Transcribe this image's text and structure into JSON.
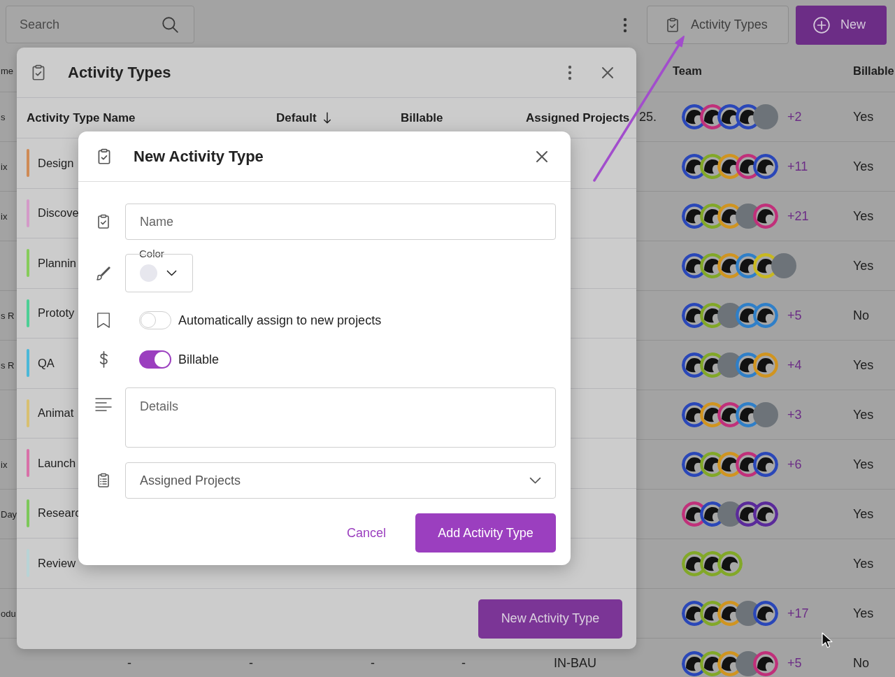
{
  "top_bar": {
    "search": {
      "placeholder": "Search"
    },
    "activity_types_button": {
      "label": "Activity Types"
    },
    "new_button": {
      "label": "New"
    }
  },
  "background_table": {
    "header": {
      "column_1": "me",
      "team": "Team",
      "billable": "Billable"
    },
    "rows": [
      {
        "column_1": "s",
        "column_7": "25.",
        "avatars": [
          {
            "kind": "illustration",
            "color": "#2a47b8"
          },
          {
            "kind": "illustration",
            "color": "#c0307a"
          },
          {
            "kind": "illustration",
            "color": "#2a47b8"
          },
          {
            "kind": "illustration",
            "color": "#2a47b8"
          },
          {
            "kind": "photo"
          }
        ],
        "more": "+2",
        "billable": "Yes"
      },
      {
        "column_1": "ix",
        "avatars": [
          {
            "kind": "illustration",
            "color": "#2a47b8"
          },
          {
            "kind": "illustration",
            "color": "#82a828"
          },
          {
            "kind": "illustration",
            "color": "#d09420"
          },
          {
            "kind": "illustration",
            "color": "#c0307a"
          },
          {
            "kind": "illustration",
            "color": "#2a47b8"
          }
        ],
        "more": "+11",
        "billable": "Yes"
      },
      {
        "column_1": "ix",
        "avatars": [
          {
            "kind": "illustration",
            "color": "#2a47b8"
          },
          {
            "kind": "illustration",
            "color": "#82a828"
          },
          {
            "kind": "illustration",
            "color": "#d09420"
          },
          {
            "kind": "photo"
          },
          {
            "kind": "illustration",
            "color": "#c0307a"
          }
        ],
        "more": "+21",
        "billable": "Yes"
      },
      {
        "avatars": [
          {
            "kind": "illustration",
            "color": "#2a47b8"
          },
          {
            "kind": "illustration",
            "color": "#82a828"
          },
          {
            "kind": "illustration",
            "color": "#d09420"
          },
          {
            "kind": "illustration",
            "color": "#2f7fc8"
          },
          {
            "kind": "illustration",
            "color": "#c8b820"
          },
          {
            "kind": "photo"
          }
        ],
        "billable": "Yes"
      },
      {
        "column_1": "s R",
        "avatars": [
          {
            "kind": "illustration",
            "color": "#2a47b8"
          },
          {
            "kind": "illustration",
            "color": "#82a828"
          },
          {
            "kind": "photo"
          },
          {
            "kind": "illustration",
            "color": "#2f7fc8"
          },
          {
            "kind": "illustration",
            "color": "#2f7fc8"
          }
        ],
        "more": "+5",
        "billable": "No"
      },
      {
        "column_1": "s R",
        "avatars": [
          {
            "kind": "illustration",
            "color": "#2a47b8"
          },
          {
            "kind": "illustration",
            "color": "#82a828"
          },
          {
            "kind": "photo"
          },
          {
            "kind": "illustration",
            "color": "#2f7fc8"
          },
          {
            "kind": "illustration",
            "color": "#d09420"
          }
        ],
        "more": "+4",
        "billable": "Yes"
      },
      {
        "avatars": [
          {
            "kind": "illustration",
            "color": "#2a47b8"
          },
          {
            "kind": "illustration",
            "color": "#d09420"
          },
          {
            "kind": "illustration",
            "color": "#c0307a"
          },
          {
            "kind": "illustration",
            "color": "#2f7fc8"
          },
          {
            "kind": "photo"
          }
        ],
        "more": "+3",
        "billable": "Yes"
      },
      {
        "column_1": "ix",
        "avatars": [
          {
            "kind": "illustration",
            "color": "#2a47b8"
          },
          {
            "kind": "illustration",
            "color": "#82a828"
          },
          {
            "kind": "illustration",
            "color": "#d09420"
          },
          {
            "kind": "illustration",
            "color": "#c0307a"
          },
          {
            "kind": "illustration",
            "color": "#2a47b8"
          }
        ],
        "more": "+6",
        "billable": "Yes"
      },
      {
        "column_1": "Day",
        "avatars": [
          {
            "kind": "illustration",
            "color": "#c0307a"
          },
          {
            "kind": "illustration",
            "color": "#2a47b8"
          },
          {
            "kind": "photo"
          },
          {
            "kind": "illustration",
            "color": "#5a2a9a"
          },
          {
            "kind": "illustration",
            "color": "#5a2a9a"
          }
        ],
        "billable": "Yes"
      },
      {
        "avatars": [
          {
            "kind": "illustration",
            "color": "#82a828"
          },
          {
            "kind": "illustration",
            "color": "#82a828"
          },
          {
            "kind": "illustration",
            "color": "#82a828"
          }
        ],
        "billable": "Yes"
      },
      {
        "column_1": "odu",
        "avatars": [
          {
            "kind": "illustration",
            "color": "#2a47b8"
          },
          {
            "kind": "illustration",
            "color": "#82a828"
          },
          {
            "kind": "illustration",
            "color": "#d09420"
          },
          {
            "kind": "photo"
          },
          {
            "kind": "illustration",
            "color": "#2a47b8"
          }
        ],
        "more": "+17",
        "billable": "Yes"
      },
      {
        "column_2": "-",
        "column_3": "-",
        "column_4": "-",
        "column_5": "-",
        "column_6": "IN-BAU",
        "avatars": [
          {
            "kind": "illustration",
            "color": "#2a47b8"
          },
          {
            "kind": "illustration",
            "color": "#82a828"
          },
          {
            "kind": "illustration",
            "color": "#d09420"
          },
          {
            "kind": "photo"
          },
          {
            "kind": "illustration",
            "color": "#c0307a"
          }
        ],
        "more": "+5",
        "billable": "No"
      }
    ]
  },
  "activity_types_panel": {
    "title": "Activity Types",
    "columns": [
      {
        "label": "Activity Type Name",
        "sorted": false
      },
      {
        "label": "Default",
        "sorted": true
      },
      {
        "label": "Billable",
        "sorted": false
      },
      {
        "label": "Assigned Projects",
        "sorted": false
      }
    ],
    "rows": [
      {
        "name": "Design",
        "color": "#cf8a55"
      },
      {
        "name": "Discove",
        "color": "#d49ac8"
      },
      {
        "name": "Plannin",
        "color": "#86cc5a"
      },
      {
        "name": "Prototy",
        "color": "#4ccf95"
      },
      {
        "name": "QA",
        "color": "#4ab8d8"
      },
      {
        "name": "Animat",
        "color": "#d8c070"
      },
      {
        "name": "Launch",
        "color": "#d870a8"
      },
      {
        "name": "Researc",
        "color": "#7cc85a"
      },
      {
        "name": "Review",
        "color": "#b8d4d6"
      }
    ],
    "footer_button": {
      "label": "New Activity Type"
    }
  },
  "modal": {
    "title": "New Activity Type",
    "name_field": {
      "placeholder": "Name"
    },
    "color_field": {
      "label": "Color"
    },
    "auto_assign": {
      "label": "Automatically assign to new projects",
      "on": false
    },
    "billable": {
      "label": "Billable",
      "on": true
    },
    "details": {
      "placeholder": "Details"
    },
    "assigned_projects": {
      "placeholder": "Assigned Projects"
    },
    "buttons": [
      {
        "label": "Cancel",
        "kind": "text"
      },
      {
        "label": "Add Activity Type",
        "kind": "primary"
      }
    ]
  }
}
